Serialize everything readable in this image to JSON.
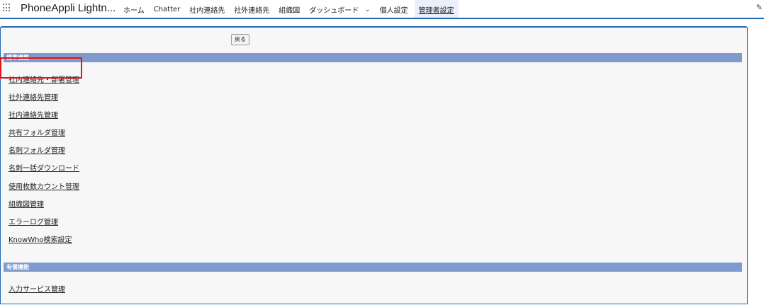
{
  "app": {
    "name": "PhoneAppli Lightn..."
  },
  "nav": {
    "items": [
      {
        "label": "ホーム"
      },
      {
        "label": "Chatter"
      },
      {
        "label": "社内連絡先"
      },
      {
        "label": "社外連絡先"
      },
      {
        "label": "組織図"
      },
      {
        "label": "ダッシュボード"
      },
      {
        "label": "個人設定"
      },
      {
        "label": "管理者設定",
        "active": true
      }
    ],
    "dropdown_icon": "chevron-down-icon",
    "edit_icon": "pencil-icon"
  },
  "page": {
    "back_label": "戻る",
    "sections": [
      {
        "title": "標準機能",
        "links": [
          "社内連絡先・部署管理",
          "社外連絡先管理",
          "社内連絡先管理",
          "共有フォルダ管理",
          "名刺フォルダ管理",
          "名刺一括ダウンロード",
          "使用枚数カウント管理",
          "組織図管理",
          "エラーログ管理",
          "KnowWho検索設定"
        ]
      },
      {
        "title": "有償機能",
        "links": [
          "入力サービス管理"
        ]
      }
    ],
    "highlight_color": "#e0141e",
    "section_header_color": "#7f9bcd",
    "accent_color": "#1f6bb3"
  }
}
